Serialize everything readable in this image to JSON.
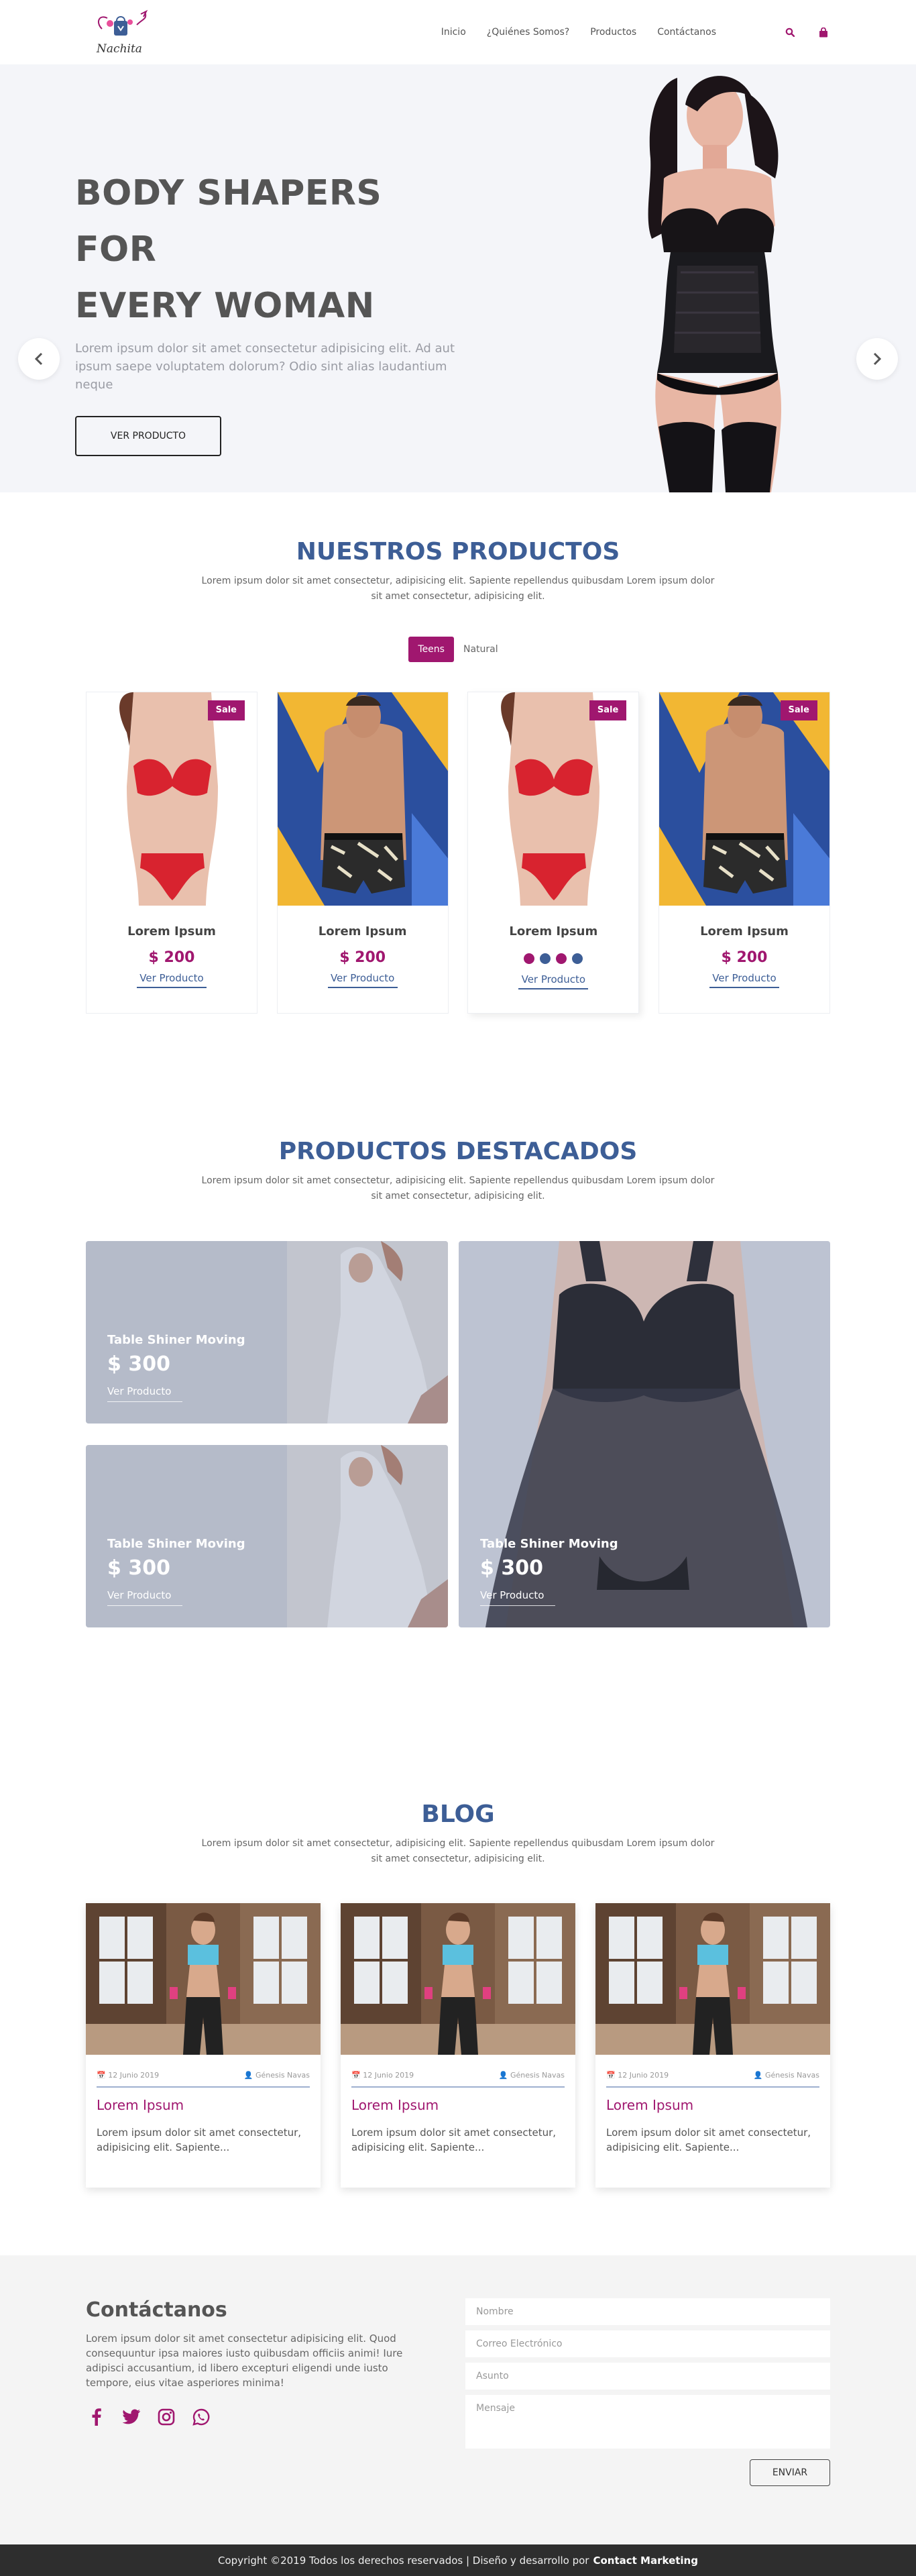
{
  "brand": {
    "name": "Nachita",
    "accent": "#a0176f",
    "blue": "#3d5e96"
  },
  "nav": {
    "items": [
      "Inicio",
      "¿Quiénes Somos?",
      "Productos",
      "Contáctanos"
    ],
    "icons": [
      "search-icon",
      "shopping-bag-icon"
    ]
  },
  "hero": {
    "title_line1": "BODY SHAPERS FOR",
    "title_line2": "EVERY WOMAN",
    "description": "Lorem ipsum dolor sit amet consectetur adipisicing elit. Ad aut ipsum saepe voluptatem dolorum? Odio sint alias laudantium neque",
    "button": "VER PRODUCTO"
  },
  "products": {
    "title": "NUESTROS PRODUCTOS",
    "subtitle": "Lorem ipsum dolor sit amet consectetur, adipisicing elit. Sapiente repellendus quibusdam Lorem ipsum dolor sit amet consectetur, adipisicing elit.",
    "tabs": [
      "Teens",
      "Natural"
    ],
    "active_tab": "Teens",
    "items": [
      {
        "name": "Lorem Ipsum",
        "price": "$ 200",
        "link": "Ver Producto",
        "badge": "Sale"
      },
      {
        "name": "Lorem Ipsum",
        "price": "$ 200",
        "link": "Ver Producto",
        "badge": ""
      },
      {
        "name": "Lorem Ipsum",
        "price": "",
        "link": "Ver Producto",
        "badge": "Sale",
        "colors": [
          "#a0176f",
          "#3d5e96",
          "#a0176f",
          "#3d5e96"
        ]
      },
      {
        "name": "Lorem Ipsum",
        "price": "$ 200",
        "link": "Ver Producto",
        "badge": "Sale"
      }
    ]
  },
  "featured": {
    "title": "PRODUCTOS DESTACADOS",
    "subtitle": "Lorem ipsum dolor sit amet consectetur, adipisicing elit. Sapiente repellendus quibusdam Lorem ipsum dolor sit amet consectetur, adipisicing elit.",
    "items": [
      {
        "name": "Table Shiner Moving",
        "price": "$ 300",
        "link": "Ver Producto"
      },
      {
        "name": "Table Shiner Moving",
        "price": "$ 300",
        "link": "Ver Producto"
      },
      {
        "name": "Table Shiner Moving",
        "price": "$ 300",
        "link": "Ver Producto"
      }
    ]
  },
  "blog": {
    "title": "BLOG",
    "subtitle": "Lorem ipsum dolor sit amet consectetur, adipisicing elit. Sapiente repellendus quibusdam Lorem ipsum dolor sit amet consectetur, adipisicing elit.",
    "posts": [
      {
        "date": "12 Junio 2019",
        "author": "Génesis Navas",
        "title": "Lorem Ipsum",
        "text": "Lorem ipsum dolor sit amet consectetur, adipisicing elit. Sapiente..."
      },
      {
        "date": "12 Junio 2019",
        "author": "Génesis Navas",
        "title": "Lorem Ipsum",
        "text": "Lorem ipsum dolor sit amet consectetur, adipisicing elit. Sapiente..."
      },
      {
        "date": "12 Junio 2019",
        "author": "Génesis Navas",
        "title": "Lorem Ipsum",
        "text": "Lorem ipsum dolor sit amet consectetur, adipisicing elit. Sapiente..."
      }
    ]
  },
  "contact": {
    "title": "Contáctanos",
    "text": "Lorem ipsum dolor sit amet consectetur adipisicing elit. Quod consequuntur ipsa maiores iusto quibusdam officiis animi! Iure adipisci accusantium, id libero excepturi eligendi unde iusto tempore, eius vitae asperiores minima!",
    "social": [
      "facebook-icon",
      "twitter-icon",
      "instagram-icon",
      "whatsapp-icon"
    ],
    "fields": {
      "name": "Nombre",
      "email": "Correo Electrónico",
      "subject": "Asunto",
      "message": "Mensaje"
    },
    "button": "ENVIAR"
  },
  "footer": {
    "text": "Copyright ©2019 Todos los derechos reservados | Diseño y desarrollo por",
    "credit": "Contact Marketing"
  }
}
